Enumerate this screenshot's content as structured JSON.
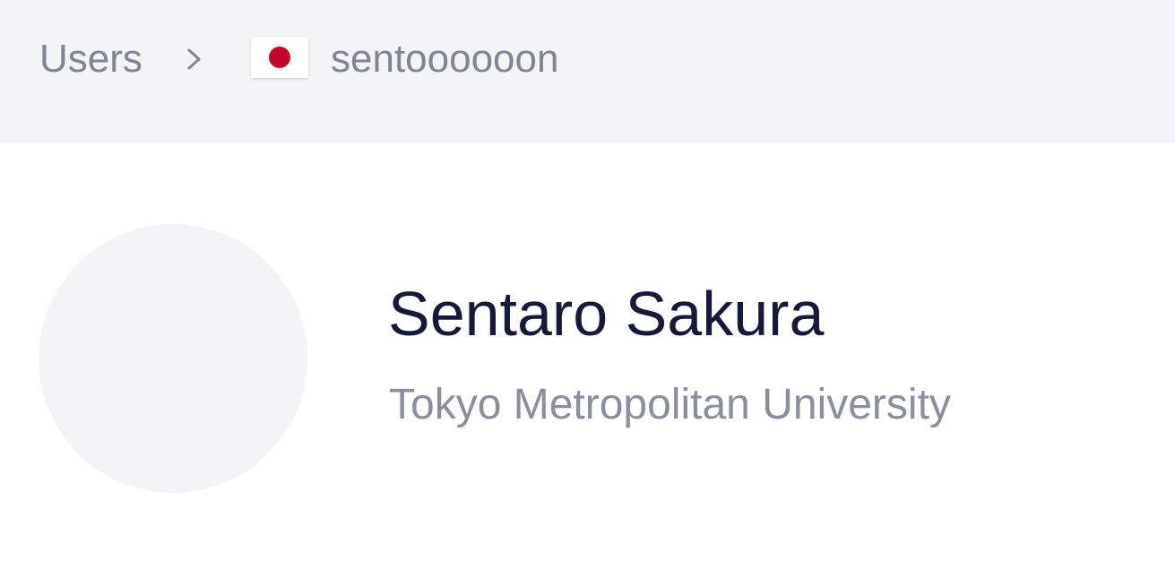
{
  "breadcrumb": {
    "root_label": "Users",
    "separator_icon": "chevron-right-icon",
    "country_flag": "japan-flag-icon",
    "username": "sentoooooon"
  },
  "profile": {
    "full_name": "Sentaro Sakura",
    "affiliation": "Tokyo Metropolitan University",
    "avatar": "avatar-placeholder"
  },
  "colors": {
    "header_bg": "#f3f4f6",
    "muted_text": "#7f8594",
    "name_text": "#161a36",
    "flag_red": "#c4042b"
  }
}
